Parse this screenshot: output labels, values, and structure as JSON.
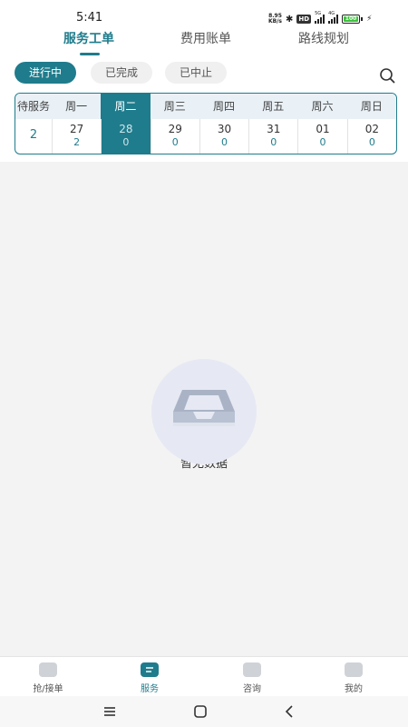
{
  "status_bar": {
    "time": "5:41",
    "net_speed_value": "8.95",
    "net_speed_unit": "KB/s",
    "hd_badge": "HD",
    "sig1_label": "5G",
    "sig2_label": "4G",
    "battery": "100"
  },
  "tabs": [
    {
      "label": "服务工单",
      "active": true
    },
    {
      "label": "费用账单",
      "active": false
    },
    {
      "label": "路线规划",
      "active": false
    }
  ],
  "filters": [
    {
      "label": "进行中",
      "active": true
    },
    {
      "label": "已完成",
      "active": false
    },
    {
      "label": "已中止",
      "active": false
    }
  ],
  "calendar": {
    "pending_label": "待服务",
    "pending_count": "2",
    "days": [
      {
        "weekday": "周一",
        "date": "27",
        "count": "2"
      },
      {
        "weekday": "周二",
        "date": "28",
        "count": "0",
        "selected": true
      },
      {
        "weekday": "周三",
        "date": "29",
        "count": "0"
      },
      {
        "weekday": "周四",
        "date": "30",
        "count": "0"
      },
      {
        "weekday": "周五",
        "date": "31",
        "count": "0"
      },
      {
        "weekday": "周六",
        "date": "01",
        "count": "0"
      },
      {
        "weekday": "周日",
        "date": "02",
        "count": "0"
      }
    ]
  },
  "empty_state": {
    "text": "暂无数据",
    "icon": "empty-tray-icon"
  },
  "bottom_nav": [
    {
      "label": "抢/接单",
      "icon": "grab-order-icon",
      "active": false
    },
    {
      "label": "服务",
      "icon": "service-icon",
      "active": true
    },
    {
      "label": "咨询",
      "icon": "chat-icon",
      "active": false
    },
    {
      "label": "我的",
      "icon": "profile-icon",
      "active": false
    }
  ],
  "colors": {
    "accent": "#1f7c8c",
    "calendar_header_bg": "#e9f1f7",
    "empty_circle": "#e6e9f3"
  }
}
